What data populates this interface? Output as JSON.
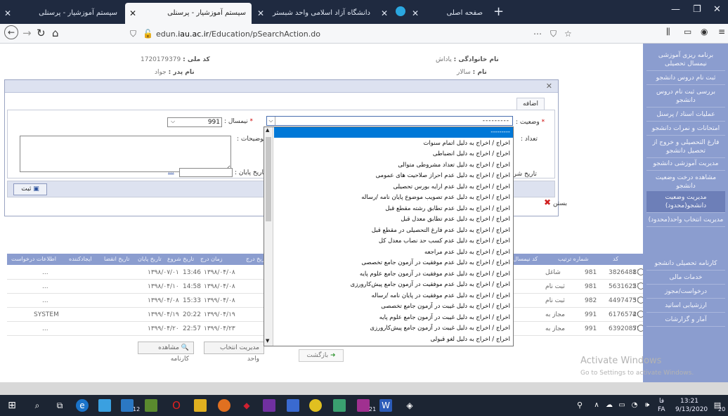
{
  "browser": {
    "tabs": [
      {
        "title": "سیستم آموزشیار - پرسنلی",
        "active": false
      },
      {
        "title": "سیستم آموزشیار - پرسنلی",
        "active": true
      },
      {
        "title": "دانشگاه آزاد اسلامی واحد شبستر",
        "active": false
      },
      {
        "title": "",
        "active": false
      },
      {
        "title": "صفحه اصلی",
        "active": false
      }
    ],
    "url_prefix": "edun.",
    "url_domain": "iau.ac.ir",
    "url_path": "/Education/pSearchAction.do"
  },
  "background": {
    "national_code_label": "کد ملی :",
    "national_code": "1720179379",
    "father_name_label": "نام پدر :",
    "father_name": "جواد",
    "family_label": "نام خانوادگی :",
    "family": "یاداش",
    "name_label": "نام :",
    "name": "سالار",
    "table_headers": [
      "اطلاعات درخواست",
      "ایجادکننده",
      "تاریخ انقضا",
      "تاریخ پایان",
      "تاریخ شروع",
      "زمان درج",
      "تاریخ درج",
      "وضعیت",
      "کد نیمسال",
      "شماره ترتیب",
      "کد"
    ],
    "rows": [
      {
        "num": "1",
        "code": "38264881",
        "term": "981",
        "status": "شاغل",
        "date": "۱۳۹۸/۰۴/۰۸",
        "time": "13:46",
        "start": "۱۳۹۸/۰۷/۰۱",
        "creator": "..."
      },
      {
        "num": "2",
        "code": "56316257",
        "term": "981",
        "status": "ثبت نام",
        "date": "۱۳۹۸/۰۴/۰۸",
        "time": "14:58",
        "start": "۱۳۹۸/۰۴/۱۰",
        "creator": "..."
      },
      {
        "num": "3",
        "code": "44974751",
        "term": "982",
        "status": "ثبت نام",
        "date": "۱۳۹۹/۰۴/۰۸",
        "time": "15:33",
        "start": "۱۳۹۹/۰۴/۰۸",
        "creator": "..."
      },
      {
        "num": "4",
        "code": "61765720",
        "term": "991",
        "status": "مجاز به",
        "date": "۱۳۹۹/۰۴/۱۹",
        "time": "20:22",
        "start": "۱۳۹۹/۰۴/۱۹",
        "creator": "SYSTEM"
      },
      {
        "num": "5",
        "code": "63920879",
        "term": "991",
        "status": "مجاز به",
        "date": "۱۳۹۹/۰۴/۲۳",
        "time": "22:57",
        "start": "۱۳۹۹/۰۴/۲۰",
        "creator": "..."
      }
    ],
    "btn_transcript": "مشاهده کارنامه",
    "btn_unit_mgmt": "مدیریت انتخاب واحد",
    "btn_back": "بازگشت"
  },
  "sidebar": {
    "items": [
      "برنامه ریزی آموزشی نیمسال تحصیلی",
      "ثبت نام دروس دانشجو",
      "بررسی ثبت نام دروس دانشجو",
      "عملیات اسناد / پرسنل",
      "امتحانات و نمرات دانشجو",
      "فارغ التحصیلی و خروج از تحصیل دانشجو",
      "مدیریت آموزشی دانشجو",
      "مشاهده درخت وضعیت دانشجو",
      "مدیریت وضعیت دانشجو(محدود)",
      "مدیریت انتخاب واحد(محدود)",
      "کارنامه تحصیلی دانشجو",
      "خدمات مالی",
      "درخواست/مجوز",
      "ارزشیابی اساتید",
      "آمار و گزارشات"
    ]
  },
  "modal": {
    "tab_label": "اضافه",
    "semester_label": "نیمسال :",
    "semester_value": "991",
    "status_label": "وضعیت :",
    "status_value": "---------",
    "count_label": "تعداد :",
    "description_label": "توضیحات :",
    "start_date_label": "تاریخ شروع :",
    "end_date_label": "تاریخ پایان :",
    "date_picker": "...",
    "save_label": "ثبت",
    "close_label": "بستن"
  },
  "dropdown_options": [
    "---------",
    "اخراج / اخراج به دلیل اتمام سنوات",
    "اخراج / اخراج به دلیل انضباطی",
    "اخراج / اخراج به دلیل تعداد مشروطی متوالی",
    "اخراج / اخراج به دلیل عدم احراز صلاحیت های عمومی",
    "اخراج / اخراج به دلیل عدم ارایه بورس تحصیلی",
    "اخراج / اخراج به دلیل عدم تصویب موضوع پایان نامه /رساله",
    "اخراج / اخراج به دلیل عدم تطابق رشته مقطع قبل",
    "اخراج / اخراج به دلیل عدم تطابق معدل قبل",
    "اخراج / اخراج به دلیل عدم فارغ التحصیلی در مقطع قبل",
    "اخراج / اخراج به دلیل عدم کسب حد نصاب معدل کل",
    "اخراج / اخراج به دلیل عدم مراجعه",
    "اخراج / اخراج به دلیل عدم موفقیت در آزمون جامع تخصصی",
    "اخراج / اخراج به دلیل عدم موفقیت در آزمون جامع علوم پایه",
    "اخراج / اخراج به دلیل عدم موفقیت در آزمون جامع پیش‌کارورزی",
    "اخراج / اخراج به دلیل عدم موفقیت در پایان نامه /رساله",
    "اخراج / اخراج به دلیل غیبت در آزمون جامع تخصصی",
    "اخراج / اخراج به دلیل غیبت در آزمون جامع علوم پایه",
    "اخراج / اخراج به دلیل غیبت در آزمون جامع پیش‌کارورزی",
    "اخراج / اخراج به دلیل لغو قبولی"
  ],
  "watermark": {
    "line1": "Activate Windows",
    "line2": "Go to Settings to activate Windows."
  },
  "taskbar": {
    "lang1": "فا",
    "lang2": "FA",
    "time": "13:21",
    "date": "9/13/2020",
    "badge1": "12",
    "badge2": "21",
    "notif": "20"
  }
}
